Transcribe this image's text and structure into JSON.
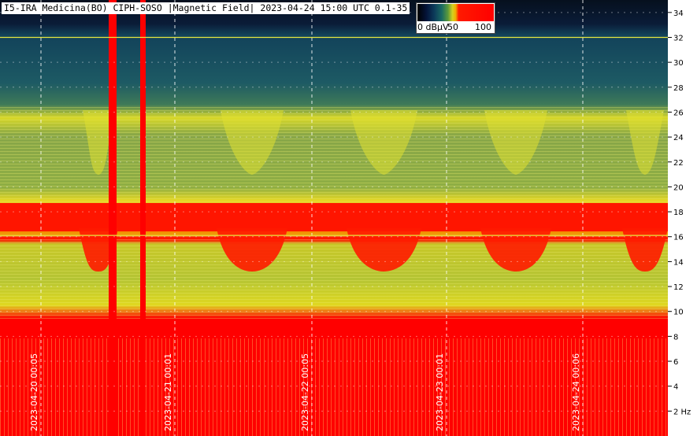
{
  "title": "I5-IRA Medicina(BO) CIPH-SOSO |Magnetic Field| 2023-04-24 15:00 UTC 0.1-35",
  "colorbar": {
    "labels": [
      "0 dBμV",
      "50",
      "100"
    ]
  },
  "chart_data": {
    "type": "heatmap",
    "title": "I5-IRA Medicina(BO) CIPH-SOSO |Magnetic Field| 2023-04-24 15:00 UTC 0.1-35",
    "y_unit": "Hz",
    "ylim": [
      0,
      35
    ],
    "y_ticks": [
      2,
      4,
      6,
      8,
      10,
      12,
      14,
      16,
      18,
      20,
      22,
      24,
      26,
      28,
      30,
      32,
      34
    ],
    "y_tick_labels": [
      "2 Hz",
      "4",
      "6",
      "8",
      "10",
      "12",
      "14",
      "16",
      "18",
      "20",
      "22",
      "24",
      "26",
      "28",
      "30",
      "32",
      "34"
    ],
    "x_ticks": [
      "2023-04-20 00:05",
      "2023-04-21 00:01",
      "2023-04-22 00:05",
      "2023-04-23 00:01",
      "2023-04-24 00:06"
    ],
    "color_scale": {
      "min": 0,
      "max": 100,
      "unit": "dBμV"
    },
    "grid": true,
    "reference_lines": [
      32,
      16.1
    ],
    "colors": {
      "low": "#04143a",
      "mid": "#5c9a3a",
      "high_yellow": "#f0e020",
      "saturated": "#ff0000"
    }
  }
}
